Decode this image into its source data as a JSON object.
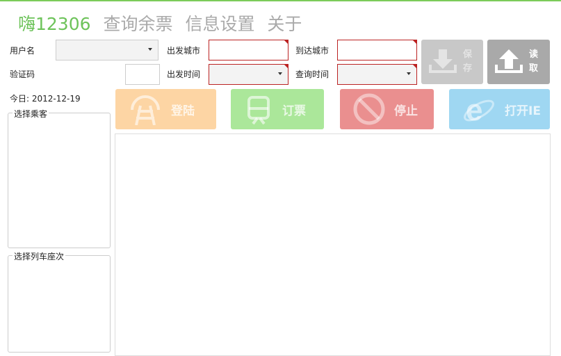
{
  "menu": {
    "brand": "嗨12306",
    "items": [
      "查询余票",
      "信息设置",
      "关于"
    ]
  },
  "form": {
    "username_label": "用户名",
    "username_value": "",
    "captcha_label": "验证码",
    "captcha_value": "",
    "from_city_label": "出发城市",
    "from_city_value": "",
    "depart_date_label": "出发时间",
    "depart_date_value": "",
    "to_city_label": "到达城市",
    "to_city_value": "",
    "query_time_label": "查询时间",
    "query_time_value": ""
  },
  "buttons": {
    "save": "保存",
    "read": "读取",
    "login": "登陆",
    "order": "订票",
    "stop": "停止",
    "open_ie": "打开IE"
  },
  "today": {
    "label": "今日:",
    "value": "2012-12-19"
  },
  "groups": {
    "passengers": "选择乘客",
    "trains": "选择列车座次"
  },
  "colors": {
    "accent": "#6dc35a",
    "login": "#fdd5a4",
    "order": "#abe79a",
    "stop": "#ea8f8f",
    "ie": "#9fd7f2",
    "save": "#c8c8c8",
    "read": "#a9a9a9"
  }
}
